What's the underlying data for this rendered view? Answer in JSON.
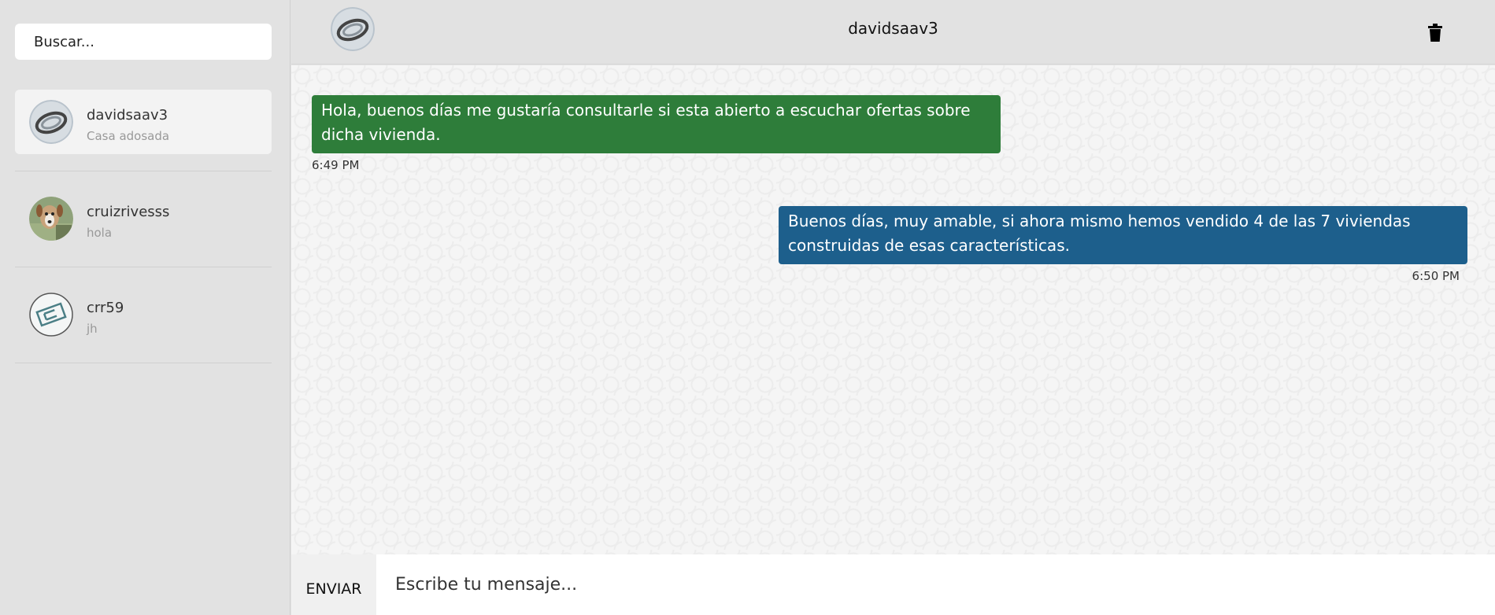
{
  "search": {
    "placeholder": "Buscar..."
  },
  "contacts": [
    {
      "name": "davidsaav3",
      "preview": "Casa adosada",
      "avatar_icon": "ring-photo-avatar"
    },
    {
      "name": "cruizrivesss",
      "preview": "hola",
      "avatar_icon": "dog-photo-avatar"
    },
    {
      "name": "crr59",
      "preview": "jh",
      "avatar_icon": "logo-avatar"
    }
  ],
  "header": {
    "title": "davidsaav3",
    "delete_icon": "trash-icon"
  },
  "messages": [
    {
      "text": "Hola, buenos días me gustaría consultarle si esta abierto a escuchar ofertas sobre dicha vivienda.",
      "time": "6:49 PM",
      "direction": "incoming",
      "color": "#2e7d3a"
    },
    {
      "text": "Buenos días, muy amable, si ahora mismo hemos vendido 4 de las 7 viviendas construidas de esas características.",
      "time": "6:50 PM",
      "direction": "outgoing",
      "color": "#1d5f8c"
    }
  ],
  "composer": {
    "send_label": "ENVIAR",
    "placeholder": "Escribe tu mensaje..."
  }
}
